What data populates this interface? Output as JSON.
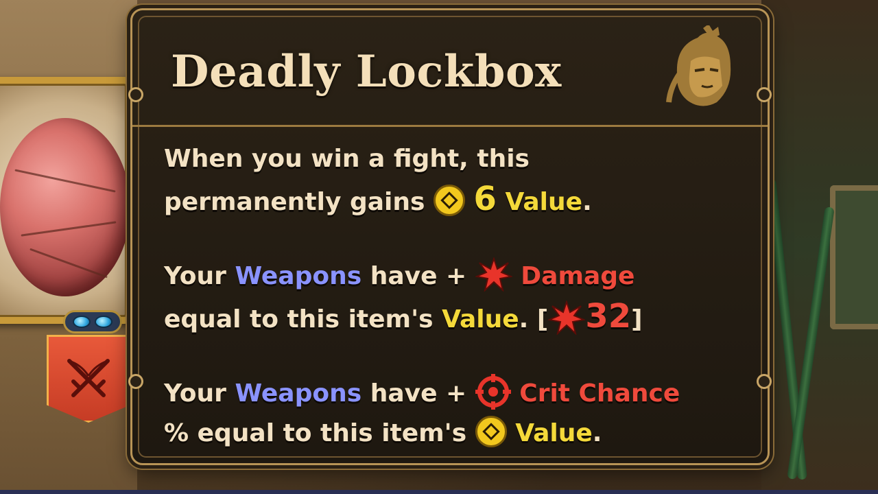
{
  "tooltip": {
    "title": "Deadly Lockbox",
    "para1": {
      "line1": "When you win a fight, this",
      "line2_pre": "permanently gains",
      "value_amount": "6",
      "value_word": "Value",
      "line2_end": "."
    },
    "para2": {
      "pre": "Your",
      "weapons": "Weapons",
      "have_plus": "have +",
      "damage": "Damage",
      "line2_pre": "equal to this item's",
      "value_word": "Value",
      "bracket_open": ". [",
      "damage_total": "32",
      "bracket_close": "]"
    },
    "para3": {
      "pre": "Your",
      "weapons": "Weapons",
      "have_plus": "have +",
      "crit": "Crit Chance",
      "line2_pre": "% equal to this item's",
      "value_word": "Value",
      "end": "."
    }
  },
  "icons": {
    "value": "value-coin-icon",
    "damage": "damage-burst-icon",
    "crit": "crit-target-icon",
    "hero": "hero-portrait-icon",
    "banner": "crossed-swords-icon",
    "gems": "enchant-gems-icon"
  },
  "colors": {
    "weapons": "#8a93ff",
    "value": "#f4d93a",
    "damage": "#ef4a3c",
    "text": "#f3e2c4",
    "frame": "#b89456"
  }
}
